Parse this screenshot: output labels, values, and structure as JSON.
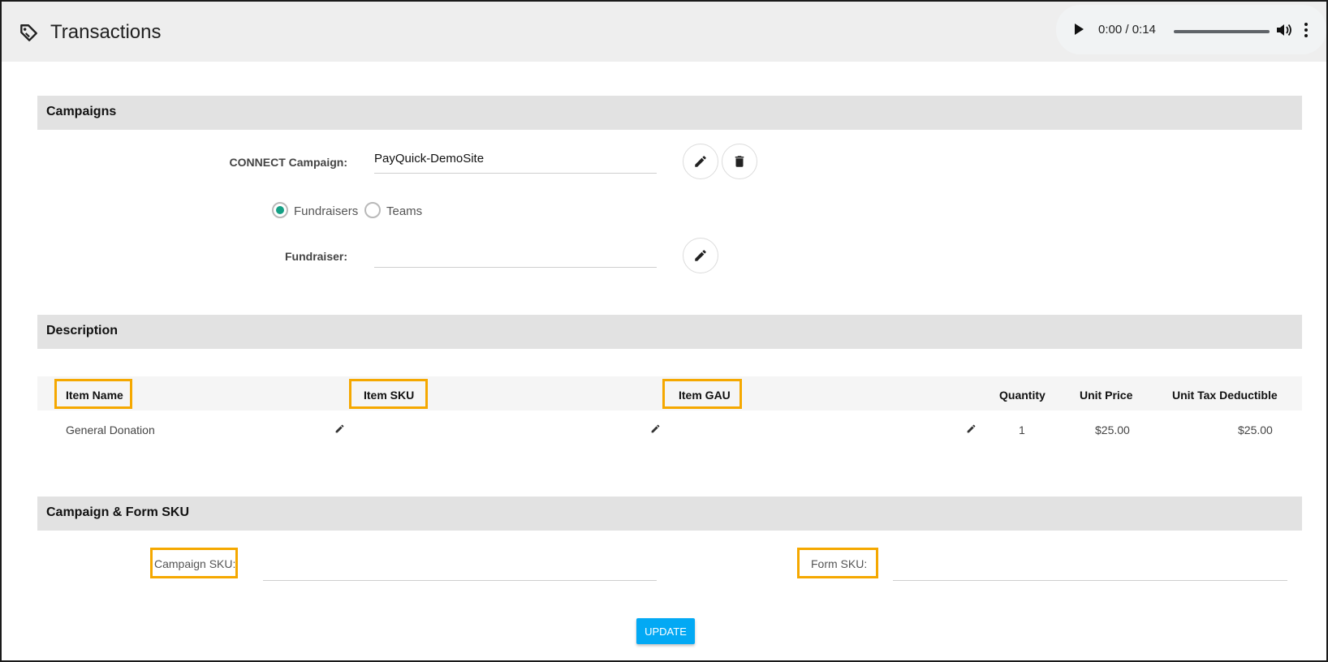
{
  "header": {
    "title": "Transactions"
  },
  "audio": {
    "time": "0:00 / 0:14"
  },
  "campaigns": {
    "heading": "Campaigns",
    "connect_label": "CONNECT Campaign:",
    "connect_value": "PayQuick-DemoSite",
    "radio_fundraisers": "Fundraisers",
    "radio_teams": "Teams",
    "selected": "Fundraisers",
    "fundraiser_label": "Fundraiser:",
    "fundraiser_value": ""
  },
  "description": {
    "heading": "Description",
    "columns": [
      "Item Name",
      "Item SKU",
      "Item GAU",
      "Quantity",
      "Unit Price",
      "Unit Tax Deductible"
    ],
    "rows": [
      {
        "item_name": "General Donation",
        "item_sku": "",
        "item_gau": "",
        "quantity": "1",
        "unit_price": "$25.00",
        "unit_tax_deductible": "$25.00"
      }
    ]
  },
  "sku": {
    "heading": "Campaign & Form SKU",
    "campaign_sku_label": "Campaign SKU:",
    "campaign_sku_value": "",
    "form_sku_label": "Form SKU:",
    "form_sku_value": ""
  },
  "actions": {
    "update_label": "UPDATE"
  },
  "colors": {
    "highlight": "#f5a800",
    "update_button": "#03a9f4",
    "radio_checked": "#15a085"
  },
  "icons": [
    "tag-icon",
    "play-icon",
    "volume-icon",
    "more-vert-icon",
    "pencil-icon",
    "trash-icon"
  ]
}
